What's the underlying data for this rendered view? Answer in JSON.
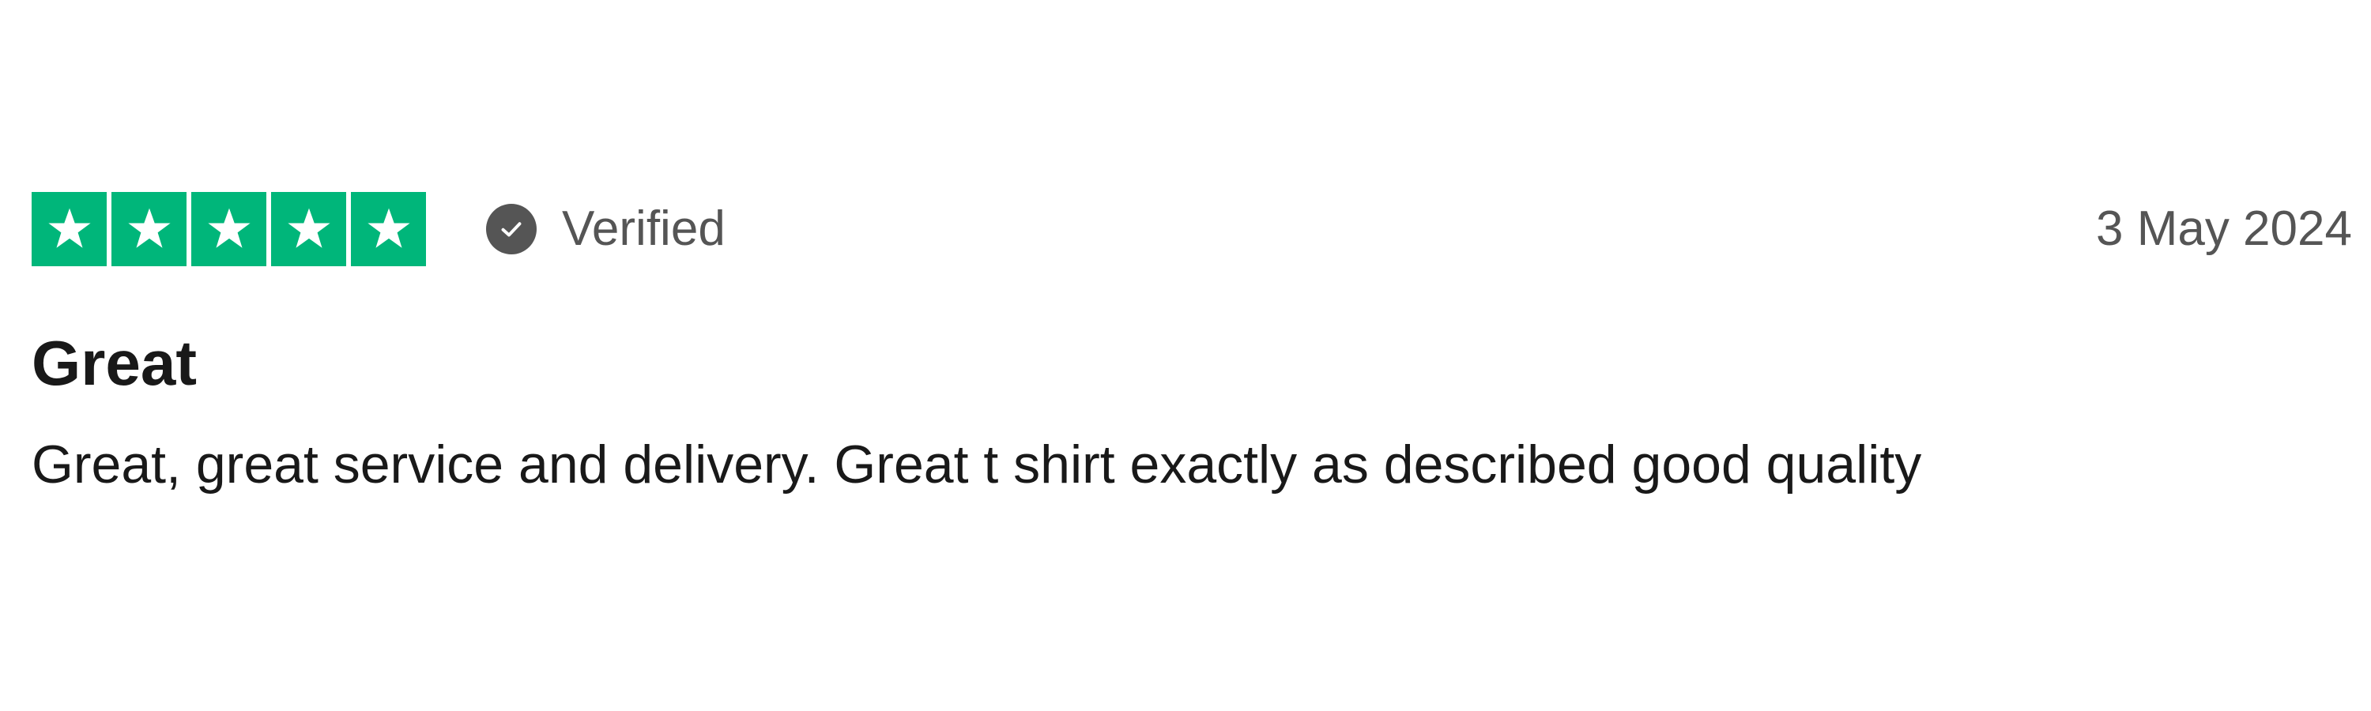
{
  "review": {
    "rating": 5,
    "rating_max": 5,
    "star_color": "#00b67a",
    "star_icon": "star-icon",
    "verified_icon": "check-circle-icon",
    "verified_label": "Verified",
    "date": "3 May 2024",
    "title": "Great",
    "body": "Great, great service and delivery. Great t shirt exactly as described good quality"
  }
}
